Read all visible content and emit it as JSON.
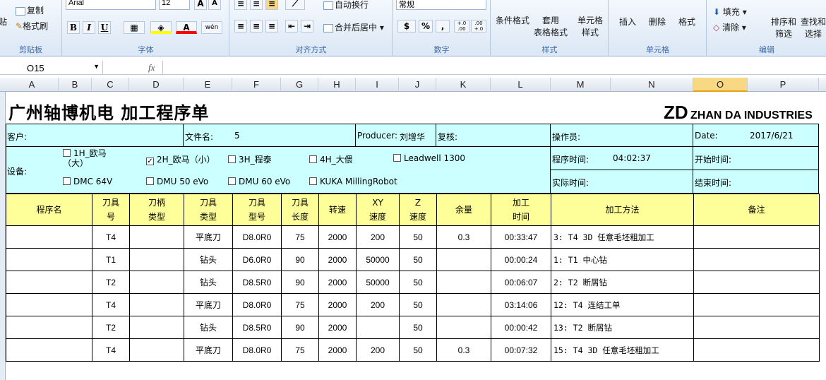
{
  "ribbon": {
    "clipboard": {
      "paste": "粘贴",
      "copy": "复制",
      "format_painter": "格式刷",
      "label": "剪贴板"
    },
    "font": {
      "name": "Arial",
      "size": "12",
      "label": "字体",
      "bold": "B",
      "italic": "I",
      "underline": "U",
      "grow": "A",
      "shrink": "A",
      "pinyin": "wén"
    },
    "align": {
      "wrap": "自动换行",
      "merge": "合并后居中",
      "label": "对齐方式"
    },
    "number": {
      "format": "常规",
      "percent": "%",
      "comma": ",",
      "inc": "+.0 .00",
      "dec": ".00 +.0",
      "label": "数字"
    },
    "styles": {
      "conditional": "条件格式",
      "table1": "套用",
      "table2": "表格格式",
      "cell1": "单元格",
      "cell2": "样式",
      "label": "样式"
    },
    "cells": {
      "insert": "插入",
      "delete": "删除",
      "format": "格式",
      "label": "单元格"
    },
    "editing": {
      "fill": "填充",
      "clear": "清除",
      "sort1": "排序和",
      "sort2": "筛选",
      "find1": "查找和",
      "find2": "选择",
      "label": "编辑"
    }
  },
  "formula_bar": {
    "name_box": "O15",
    "fx": "fx",
    "value": ""
  },
  "columns": [
    "A",
    "B",
    "C",
    "D",
    "E",
    "F",
    "G",
    "H",
    "I",
    "J",
    "K",
    "L",
    "M",
    "N",
    "O",
    "P"
  ],
  "selected_column": "O",
  "sheet": {
    "title": "广州轴博机电 加工程序单",
    "logo_mark": "ZD",
    "logo_company": "ZHAN DA INDUSTRIES",
    "info": {
      "customer_label": "客户:",
      "filename_label": "文件名:",
      "filename_value": "5",
      "producer_label": "Producer:",
      "producer_value": "刘增华",
      "review_label": "复核:",
      "operator_label": "操作员:",
      "date_label": "Date:",
      "date_value": "2017/6/21",
      "device_label": "设备:",
      "program_time_label": "程序时间:",
      "program_time_value": "04:02:37",
      "start_time_label": "开始时间:",
      "actual_time_label": "实际时间:",
      "end_time_label": "结束时间:"
    },
    "machines": [
      {
        "label": "1H_欧马",
        "label2": "（大）",
        "checked": false
      },
      {
        "label": "2H_欧马（小）",
        "checked": true
      },
      {
        "label": "3H_程泰",
        "checked": false
      },
      {
        "label": "4H_大偎",
        "checked": false
      },
      {
        "label": "Leadwell 1300",
        "checked": false
      },
      {
        "label": "DMC 64V",
        "checked": false
      },
      {
        "label": "DMU 50 eVo",
        "checked": false
      },
      {
        "label": "DMU 60 eVo",
        "checked": false
      },
      {
        "label": "KUKA MillingRobot",
        "checked": false
      }
    ],
    "headers": [
      "程序名",
      "刀具\n号",
      "刀柄\n类型",
      "刀具\n类型",
      "刀具\n型号",
      "刀具\n长度",
      "转速",
      "XY\n速度",
      "Z\n速度",
      "余量",
      "加工\n时间",
      "加工方法",
      "备注"
    ],
    "rows": [
      [
        "",
        "T4",
        "",
        "平底刀",
        "D8.0R0",
        "75",
        "2000",
        "200",
        "50",
        "0.3",
        "00:33:47",
        "3: T4 3D 任意毛坯粗加工",
        ""
      ],
      [
        "",
        "T1",
        "",
        "钻头",
        "D6.0R0",
        "90",
        "2000",
        "50000",
        "50",
        "",
        "00:00:24",
        "1: T1 中心钻",
        ""
      ],
      [
        "",
        "T2",
        "",
        "钻头",
        "D8.5R0",
        "90",
        "2000",
        "50000",
        "50",
        "",
        "00:06:07",
        "2: T2 断屑钻",
        ""
      ],
      [
        "",
        "T4",
        "",
        "平底刀",
        "D8.0R0",
        "75",
        "2000",
        "200",
        "50",
        "",
        "03:14:06",
        "12: T4 连结工单",
        ""
      ],
      [
        "",
        "T2",
        "",
        "钻头",
        "D8.5R0",
        "90",
        "2000",
        "",
        "50",
        "",
        "00:00:42",
        "13: T2 断屑钻",
        ""
      ],
      [
        "",
        "T4",
        "",
        "平底刀",
        "D8.0R0",
        "75",
        "2000",
        "200",
        "50",
        "0.3",
        "00:07:32",
        "15: T4 3D 任意毛坯粗加工",
        ""
      ]
    ]
  }
}
